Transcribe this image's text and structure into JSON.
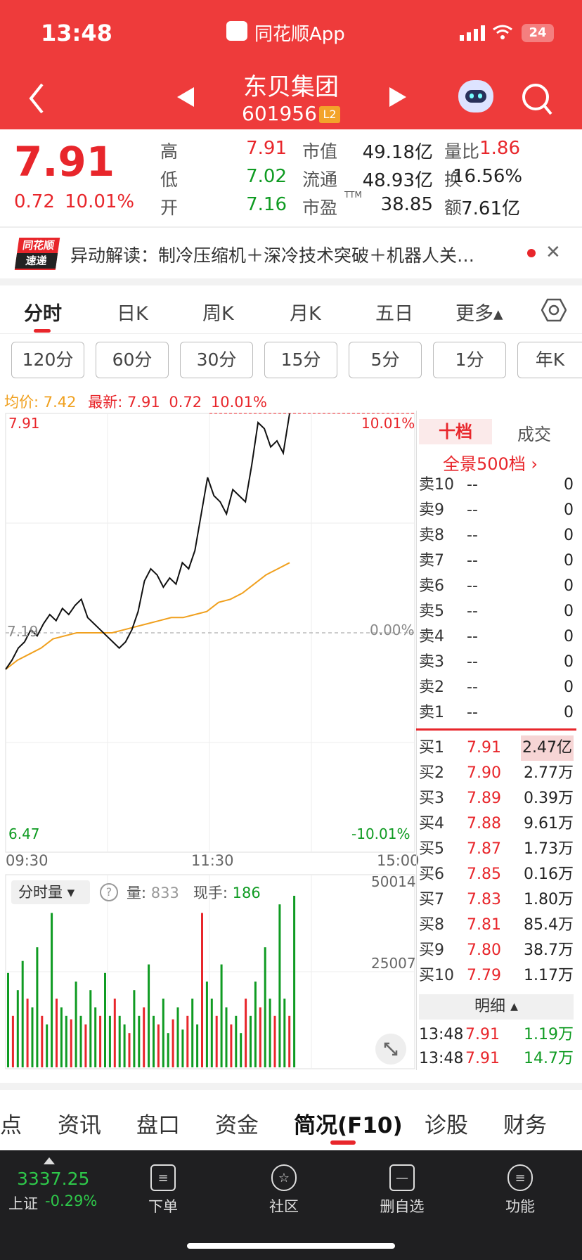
{
  "statusbar": {
    "time": "13:48",
    "app": "同花顺App",
    "battery": "24"
  },
  "header": {
    "name": "东贝集团",
    "code": "601956",
    "level": "L2"
  },
  "quote": {
    "price": "7.91",
    "change": "0.72",
    "pct": "10.01%",
    "stats": [
      {
        "l": "高",
        "v": "7.91",
        "c": "red"
      },
      {
        "l": "市值",
        "v": "49.18亿",
        "c": ""
      },
      {
        "l": "量比",
        "v": "1.86",
        "c": "red"
      },
      {
        "l": "低",
        "v": "7.02",
        "c": "green"
      },
      {
        "l": "流通",
        "v": "48.93亿",
        "c": ""
      },
      {
        "l": "换",
        "v": "16.56%",
        "c": ""
      },
      {
        "l": "开",
        "v": "7.16",
        "c": "green"
      },
      {
        "l": "市盈",
        "v": "38.85",
        "c": ""
      },
      {
        "l": "额",
        "v": "7.61亿",
        "c": ""
      }
    ],
    "ttm": "TTM"
  },
  "news": {
    "badge1": "同花顺",
    "badge2": "速递",
    "text": "异动解读：制冷压缩机＋深冷技术突破＋机器人关…"
  },
  "tabs": [
    "分时",
    "日K",
    "周K",
    "月K",
    "五日",
    "更多▴"
  ],
  "periods": [
    "120分",
    "60分",
    "30分",
    "15分",
    "5分",
    "1分",
    "年K"
  ],
  "chartinfo": {
    "avg": "均价: 7.42",
    "latest": "最新: 7.91",
    "chg": "0.72",
    "pct": "10.01%"
  },
  "chart_data": {
    "type": "line",
    "y_top": "7.91",
    "y_mid": "7.19",
    "y_bot": "6.47",
    "pct_top": "10.01%",
    "pct_mid": "0.00%",
    "pct_bot": "-10.01%",
    "x_ticks": [
      "09:30",
      "11:30",
      "15:00"
    ],
    "ylim": [
      6.47,
      7.91
    ],
    "series": [
      {
        "name": "price",
        "color": "#111111"
      },
      {
        "name": "avg",
        "color": "#f0a01e"
      }
    ],
    "price": [
      7.07,
      7.1,
      7.14,
      7.16,
      7.2,
      7.18,
      7.22,
      7.25,
      7.23,
      7.27,
      7.25,
      7.28,
      7.3,
      7.24,
      7.22,
      7.2,
      7.18,
      7.16,
      7.14,
      7.16,
      7.2,
      7.26,
      7.36,
      7.4,
      7.38,
      7.34,
      7.37,
      7.35,
      7.42,
      7.4,
      7.46,
      7.58,
      7.7,
      7.64,
      7.62,
      7.58,
      7.66,
      7.64,
      7.62,
      7.74,
      7.88,
      7.86,
      7.8,
      7.82,
      7.78,
      7.91
    ],
    "avg": [
      7.07,
      7.1,
      7.12,
      7.14,
      7.17,
      7.18,
      7.19,
      7.19,
      7.19,
      7.19,
      7.2,
      7.21,
      7.22,
      7.23,
      7.24,
      7.24,
      7.25,
      7.26,
      7.29,
      7.3,
      7.32,
      7.35,
      7.38,
      7.4,
      7.42
    ],
    "volume": [
      0.55,
      0.3,
      0.45,
      0.62,
      0.4,
      0.35,
      0.7,
      0.3,
      0.25,
      0.9,
      0.4,
      0.35,
      0.3,
      0.28,
      0.5,
      0.3,
      0.25,
      0.45,
      0.35,
      0.3,
      0.55,
      0.3,
      0.4,
      0.3,
      0.25,
      0.2,
      0.45,
      0.3,
      0.35,
      0.6,
      0.3,
      0.25,
      0.4,
      0.2,
      0.28,
      0.35,
      0.22,
      0.3,
      0.4,
      0.25,
      0.9,
      0.5,
      0.4,
      0.3,
      0.6,
      0.35,
      0.25,
      0.3,
      0.2,
      0.4,
      0.3,
      0.5,
      0.35,
      0.7,
      0.4,
      0.3,
      0.95,
      0.4,
      0.3,
      1.0
    ]
  },
  "volume": {
    "sel": "分时量 ▾",
    "q": "量:",
    "qv": "833",
    "hand": "现手:",
    "hv": "186",
    "ymax": "50014",
    "ymid": "25007"
  },
  "orderbook": {
    "tab1": "十档",
    "tab2": "成交",
    "full": "全景500档 ›",
    "asks": [
      [
        "卖10",
        "--",
        "0"
      ],
      [
        "卖9",
        "--",
        "0"
      ],
      [
        "卖8",
        "--",
        "0"
      ],
      [
        "卖7",
        "--",
        "0"
      ],
      [
        "卖6",
        "--",
        "0"
      ],
      [
        "卖5",
        "--",
        "0"
      ],
      [
        "卖4",
        "--",
        "0"
      ],
      [
        "卖3",
        "--",
        "0"
      ],
      [
        "卖2",
        "--",
        "0"
      ],
      [
        "卖1",
        "--",
        "0"
      ]
    ],
    "bids": [
      [
        "买1",
        "7.91",
        "2.47亿"
      ],
      [
        "买2",
        "7.90",
        "2.77万"
      ],
      [
        "买3",
        "7.89",
        "0.39万"
      ],
      [
        "买4",
        "7.88",
        "9.61万"
      ],
      [
        "买5",
        "7.87",
        "1.73万"
      ],
      [
        "买6",
        "7.85",
        "0.16万"
      ],
      [
        "买7",
        "7.83",
        "1.80万"
      ],
      [
        "买8",
        "7.81",
        "85.4万"
      ],
      [
        "买9",
        "7.80",
        "38.7万"
      ],
      [
        "买10",
        "7.79",
        "1.17万"
      ]
    ],
    "detail": "明细 ▴",
    "trades": [
      [
        "13:48",
        "7.91",
        "1.19万"
      ],
      [
        "13:48",
        "7.91",
        "14.7万"
      ]
    ]
  },
  "subtabs": [
    "点",
    "资讯",
    "盘口",
    "资金",
    "简况(F10)",
    "诊股",
    "财务"
  ],
  "bottom": {
    "index": "3337.25",
    "iname": "上证",
    "ipct": "-0.29%",
    "items": [
      "下单",
      "社区",
      "删自选",
      "功能"
    ]
  }
}
